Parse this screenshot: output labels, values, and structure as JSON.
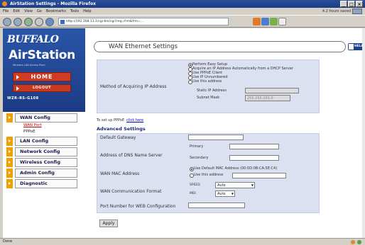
{
  "window": {
    "title": "AirStation Settings - Mozilla Firefox",
    "controls": [
      "_",
      "□",
      "×"
    ]
  },
  "menu": [
    "File",
    "Edit",
    "View",
    "Go",
    "Bookmarks",
    "Tools",
    "Help"
  ],
  "menu_right": "4.2 hours saved",
  "address": {
    "url": "http://192.168.11.1/cgi-bin/cgi?req=frm&frm=..."
  },
  "brand": {
    "logo": "BUFFALO",
    "product": "AirStation",
    "tagline": "Wireless LAN Access Point",
    "home": "HOME",
    "logout": "LOGOUT",
    "model": "WZR-RS-G108"
  },
  "sidebar": {
    "items": [
      {
        "label": "WAN Config"
      },
      {
        "label": "LAN Config"
      },
      {
        "label": "Network Config"
      },
      {
        "label": "Wireless Config"
      },
      {
        "label": "Admin Config"
      },
      {
        "label": "Diagnostic"
      }
    ],
    "subs": [
      "WAN Port",
      "PPPoE"
    ]
  },
  "page_title": "WAN Ethernet Settings",
  "help_label": "HELP",
  "method": {
    "label": "Method of Acquiring IP Address",
    "options": [
      "Perform Easy Setup",
      "Acquire an IP Address Automatically from a DHCP Server",
      "Use PPPoE Client",
      "Use IP Unnumbered",
      "Use this address"
    ],
    "static_ip_label": "Static IP Address",
    "subnet_label": "Subnet Mask",
    "subnet_value": "255.255.255.0"
  },
  "pppoe": {
    "text": "To set up PPPoE",
    "link": "click here"
  },
  "advanced": {
    "title": "Advanced Settings",
    "default_gateway": "Default Gateway",
    "dns": {
      "label": "Address of DNS Name Server",
      "primary": "Primary",
      "secondary": "Secondary"
    },
    "mac": {
      "label": "WAN MAC Address",
      "opt1": "Use Default MAC Address (00:0D:0B:CA:5E:C4)",
      "opt2": "Use this address"
    },
    "comm": {
      "label": "WAN Communication Format",
      "speed_label": "SPEED",
      "speed_val": "Auto",
      "mdi_label": "MDI",
      "mdi_val": "Auto"
    },
    "port": {
      "label": "Port Number for WEB Configuration"
    }
  },
  "apply": "Apply",
  "status": "Done"
}
